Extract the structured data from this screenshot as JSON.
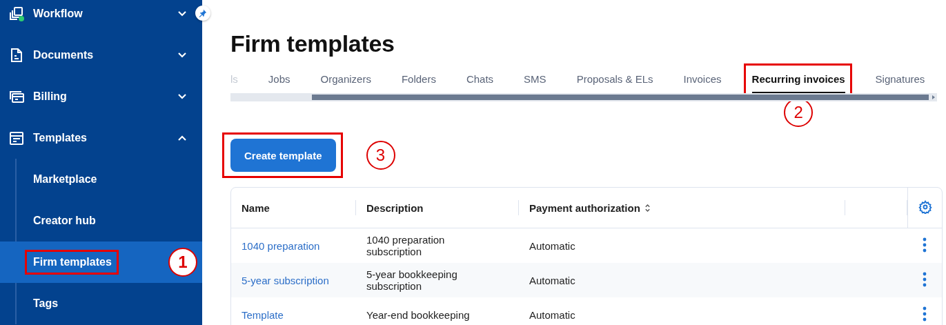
{
  "sidebar": {
    "items": [
      {
        "label": "Workflow",
        "expanded": false
      },
      {
        "label": "Documents",
        "expanded": false
      },
      {
        "label": "Billing",
        "expanded": false
      },
      {
        "label": "Templates",
        "expanded": true,
        "children": [
          {
            "label": "Marketplace",
            "selected": false
          },
          {
            "label": "Creator hub",
            "selected": false
          },
          {
            "label": "Firm templates",
            "selected": true,
            "annotation": "1"
          },
          {
            "label": "Tags",
            "selected": false
          }
        ]
      }
    ]
  },
  "page": {
    "title": "Firm templates"
  },
  "tabs": [
    {
      "label": "ls",
      "selected": false
    },
    {
      "label": "Jobs",
      "selected": false
    },
    {
      "label": "Organizers",
      "selected": false
    },
    {
      "label": "Folders",
      "selected": false
    },
    {
      "label": "Chats",
      "selected": false
    },
    {
      "label": "SMS",
      "selected": false
    },
    {
      "label": "Proposals & ELs",
      "selected": false
    },
    {
      "label": "Invoices",
      "selected": false
    },
    {
      "label": "Recurring invoices",
      "selected": true,
      "annotation": "2"
    },
    {
      "label": "Signatures",
      "selected": false
    }
  ],
  "create_button": {
    "label": "Create template",
    "annotation": "3"
  },
  "table": {
    "columns": [
      {
        "label": "Name",
        "sortable": false
      },
      {
        "label": "Description",
        "sortable": false
      },
      {
        "label": "Payment authorization",
        "sortable": true
      }
    ],
    "rows": [
      {
        "name": "1040 preparation",
        "description": "1040 preparation subscription",
        "payment": "Automatic"
      },
      {
        "name": "5-year subscription",
        "description": "5-year bookkeeping subscription",
        "payment": "Automatic"
      },
      {
        "name": "Template",
        "description": "Year-end bookkeeping",
        "payment": "Automatic"
      }
    ]
  }
}
